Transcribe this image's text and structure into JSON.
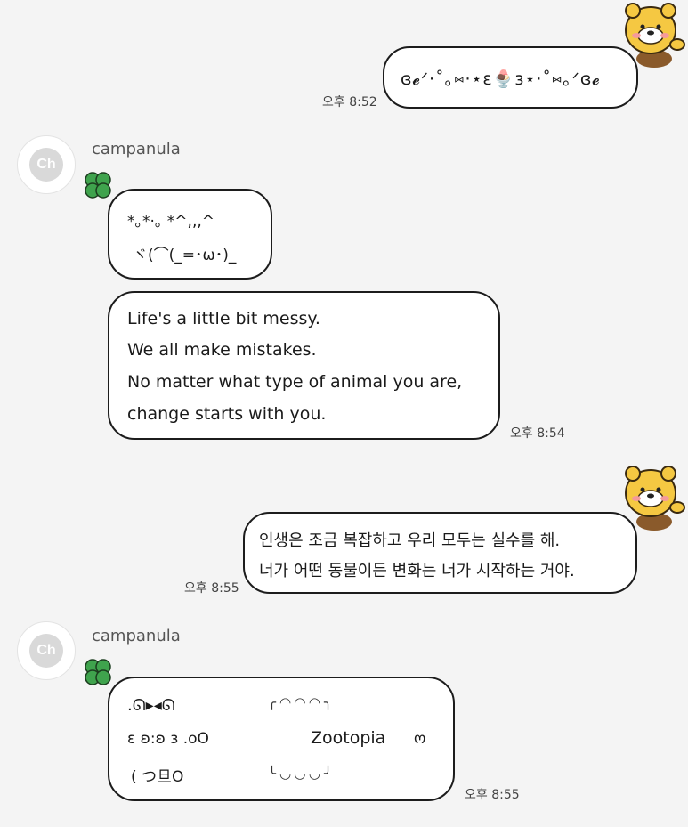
{
  "messages": [
    {
      "side": "right",
      "content": "ɞ𝓮ᐟ·˚｡⑅·⋆ɛ🍨ɜ⋆·˚⑅｡ᐟɞ𝓮",
      "time": "오후 8:52"
    },
    {
      "side": "left",
      "sender": "campanula",
      "avatar_text": "Ch",
      "bubbles": [
        {
          "lines": [
            "*｡*·｡  *^,,,^",
            "ヾ(⌒(_=･ω･)_"
          ]
        },
        {
          "lines": [
            "Life's a little bit messy.",
            "We all make mistakes.",
            "No matter what type of animal you are,",
            "change starts with you."
          ]
        }
      ],
      "time": "오후 8:54"
    },
    {
      "side": "right",
      "lines": [
        "인생은 조금 복잡하고 우리 모두는 실수를 해.",
        "너가 어떤 동물이든 변화는 너가 시작하는 거야."
      ],
      "time": "오후 8:55"
    },
    {
      "side": "left",
      "sender": "campanula",
      "avatar_text": "Ch",
      "art": {
        "row1_left": ".ᘏ▸◂ᘏ",
        "row2_left": "ɛ ʚ:ʚ ɜ   .oO",
        "row3_left": "( つ旦O",
        "center_text": "Zootopia",
        "right_mark": "ო",
        "frame_top": "╭ ◜◝   ◜◝   ◜◝ ╮",
        "frame_bottom": "╰ ◟◞   ◟◞   ◟◞ ╯"
      },
      "time": "오후 8:55"
    }
  ],
  "colors": {
    "background": "#f4f4f4",
    "bubble": "#ffffff",
    "border": "#1c1c1c",
    "clover": "#3fa34d",
    "character": "#f5c842"
  }
}
